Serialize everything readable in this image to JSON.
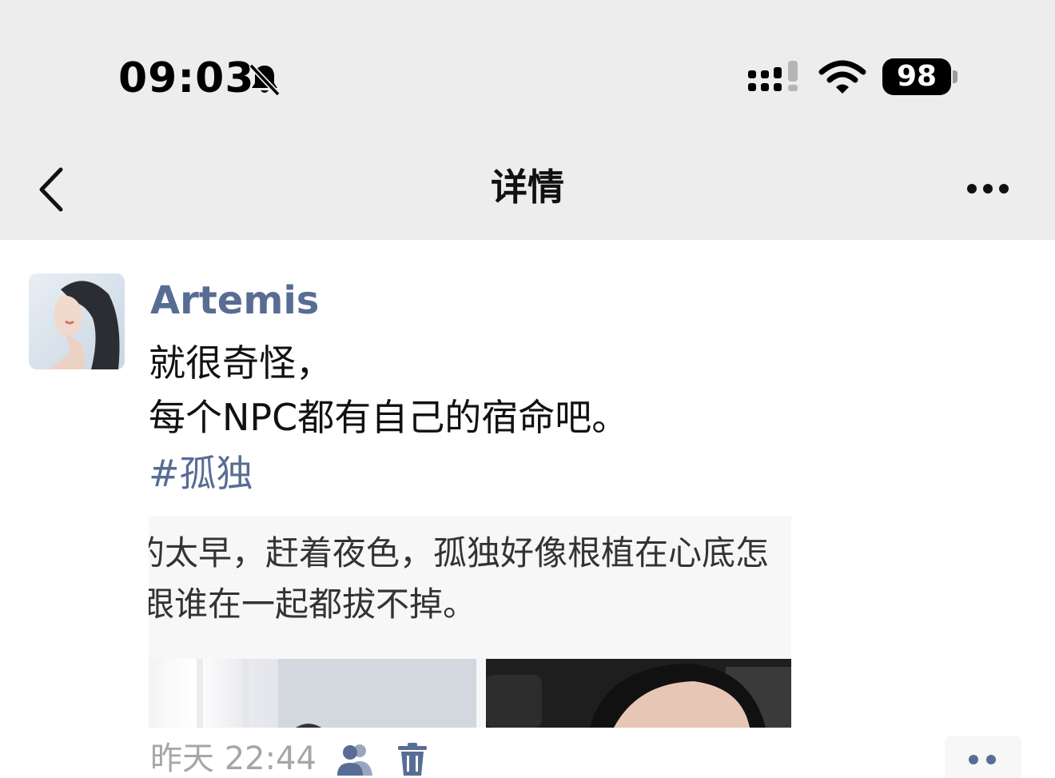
{
  "status_bar": {
    "time": "09:03",
    "battery": "98",
    "icons": [
      "bell-off-icon",
      "cellular-signal-icon",
      "wifi-icon",
      "battery-icon"
    ]
  },
  "nav": {
    "title": "详情",
    "icons": [
      "chevron-left-icon",
      "more-icon"
    ]
  },
  "post": {
    "author": "Artemis",
    "text_lines": [
      "就很奇怪，",
      "每个NPC都有自己的宿命吧。"
    ],
    "hashtag": "#孤独",
    "shared_card": {
      "lines": [
        "的太早，赶着夜色，孤独好像根植在心底怎",
        "跟谁在一起都拔不掉。"
      ]
    },
    "time": "昨天 22:44",
    "icons": [
      "friends-visibility-icon",
      "trash-icon",
      "comment-action-icon"
    ]
  },
  "colors": {
    "link": "#586c94",
    "header_bg": "#ededed",
    "meta_gray": "#a6a6a6"
  }
}
